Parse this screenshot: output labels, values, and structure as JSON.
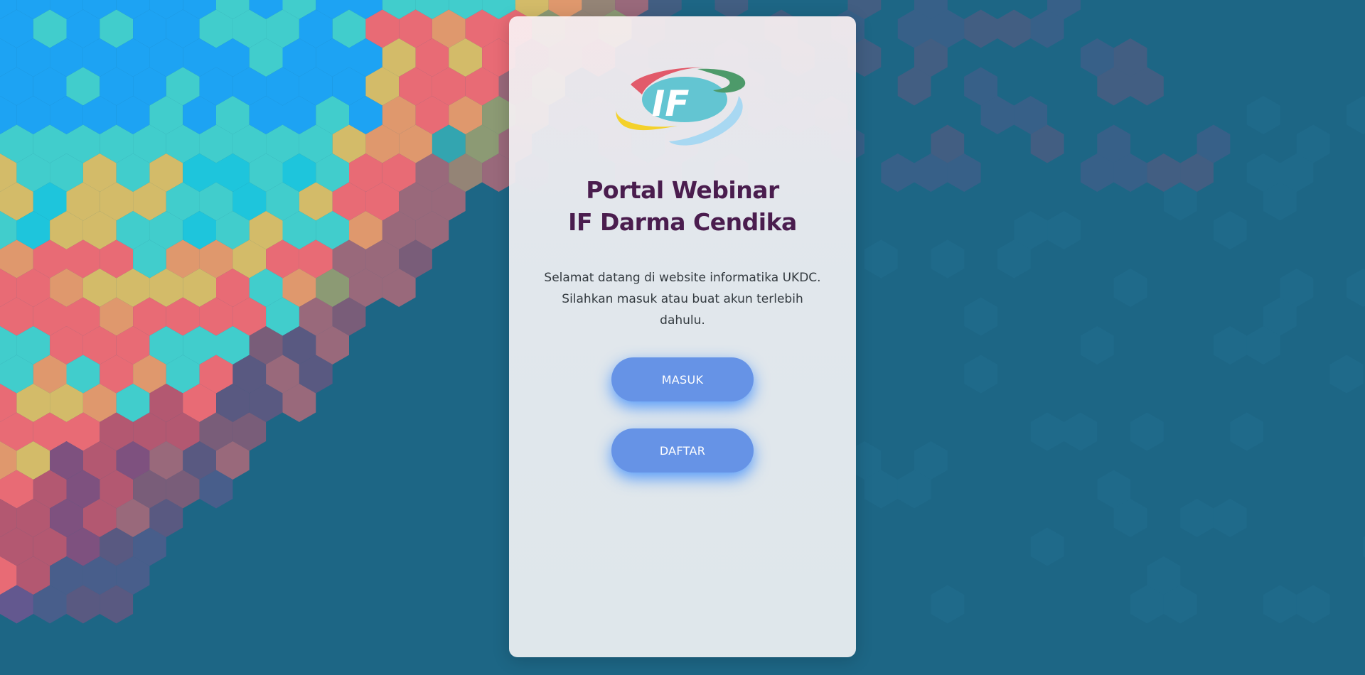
{
  "background": {
    "base_color": "#1d6685",
    "palette": [
      "#1eaaff",
      "#46d8d4",
      "#1fcfe6",
      "#e8c466",
      "#ff6b73",
      "#f59d6a",
      "#c4566f",
      "#8a4f7e",
      "#6b5790"
    ]
  },
  "card": {
    "logo_text": "IF",
    "title_line1": "Portal Webinar",
    "title_line2": "IF Darma Cendika",
    "intro_line1": "Selamat datang di website informatika UKDC.",
    "intro_line2": "Silahkan masuk atau buat akun terlebih",
    "intro_line3": "dahulu.",
    "buttons": {
      "login_label": "MASUK",
      "register_label": "DAFTAR"
    },
    "colors": {
      "title": "#4a1d4e",
      "button": "#6693e6",
      "button_glow": "#2680ff"
    }
  }
}
